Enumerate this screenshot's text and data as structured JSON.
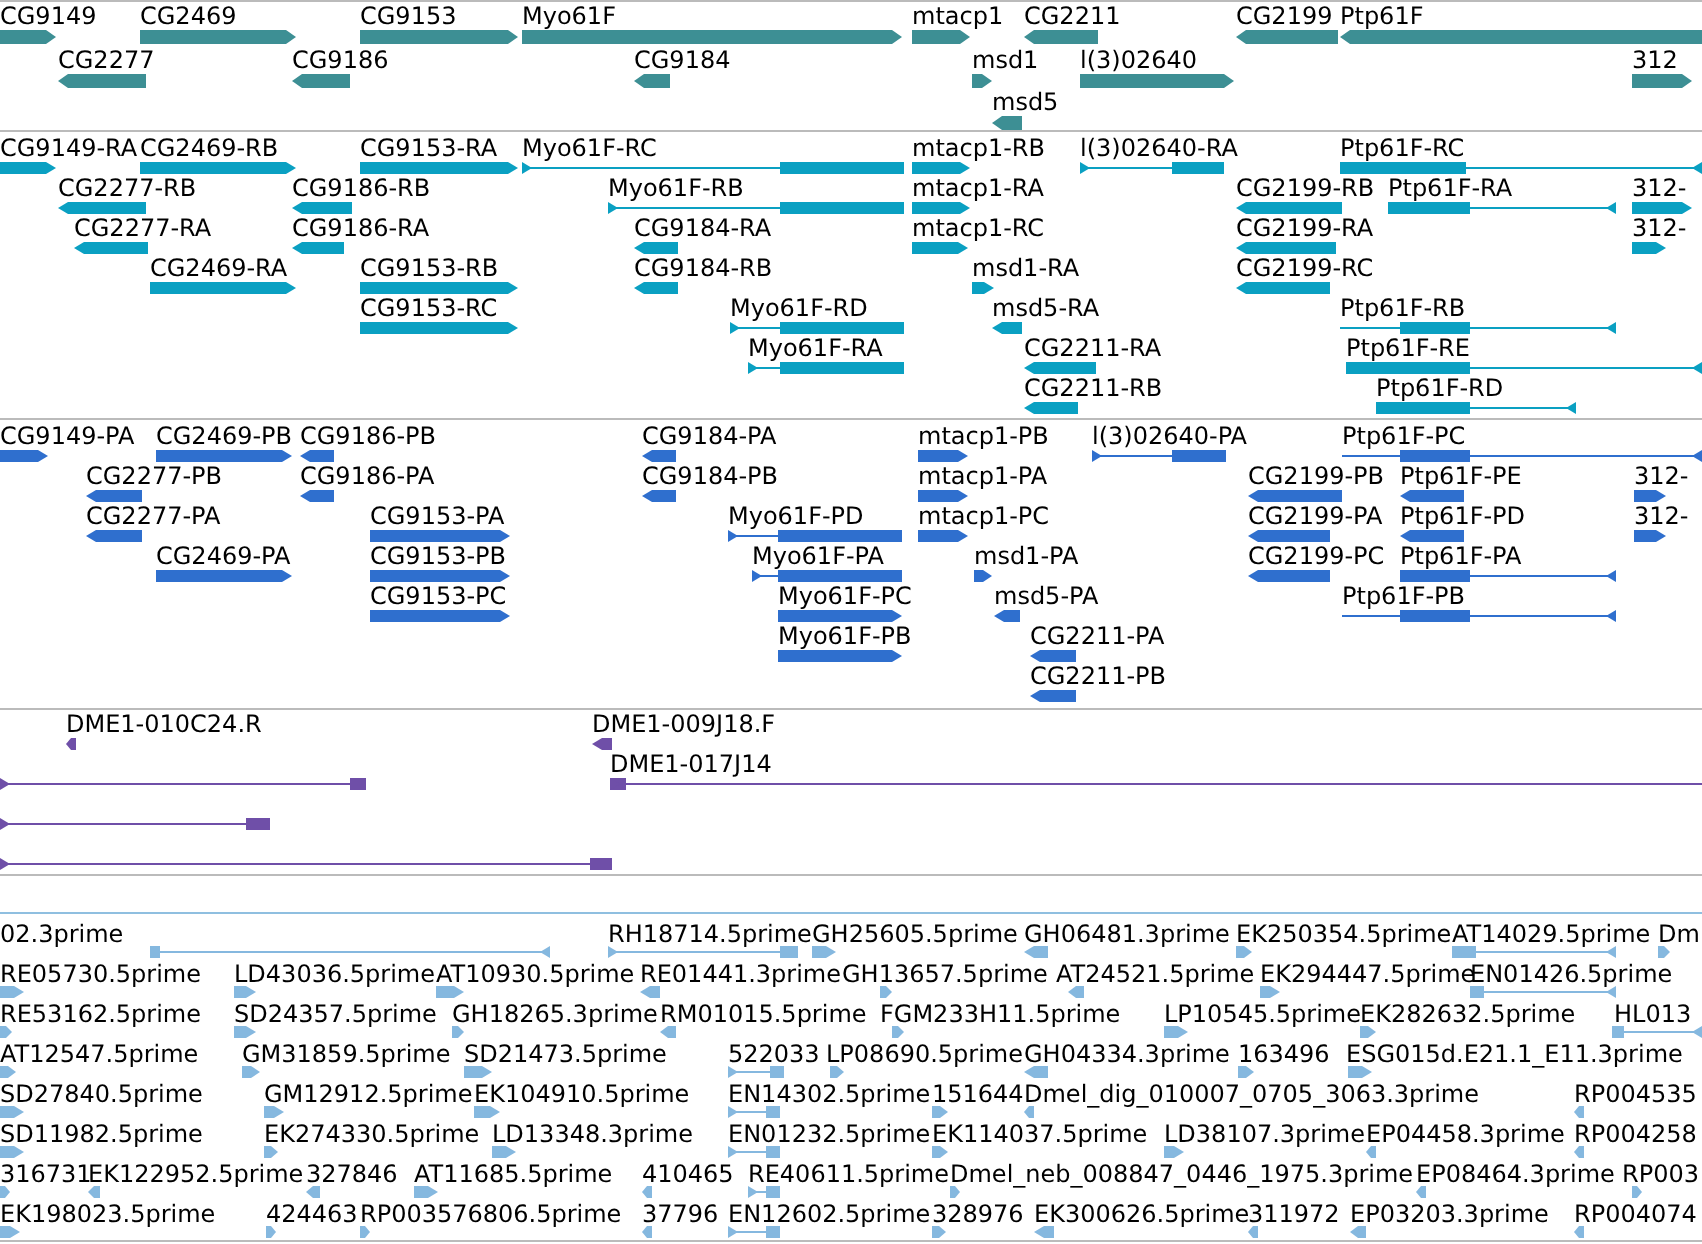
{
  "tracks": [
    {
      "color": "#3d8f94",
      "lanes": [
        {
          "features": [
            {
              "label": "CG9149",
              "reverse": false
            },
            {
              "label": "CG2469",
              "reverse": false
            },
            {
              "label": "CG9153",
              "reverse": false
            },
            {
              "label": "Myo61F",
              "reverse": false
            },
            {
              "label": "mtacp1",
              "reverse": false
            },
            {
              "label": "CG2211",
              "reverse": true
            },
            {
              "label": "CG2199",
              "reverse": true
            },
            {
              "label": "Ptp61F",
              "reverse": true
            }
          ]
        },
        {
          "features": [
            {
              "label": "CG2277",
              "reverse": true
            },
            {
              "label": "CG9186",
              "reverse": true
            },
            {
              "label": "CG9184",
              "reverse": true
            },
            {
              "label": "msd1",
              "reverse": false
            },
            {
              "label": "l(3)02640",
              "reverse": false
            },
            {
              "label": "312",
              "reverse": false
            }
          ]
        },
        {
          "features": [
            {
              "label": "msd5",
              "reverse": true
            }
          ]
        }
      ]
    },
    {
      "color": "#0aa0c2",
      "lanes": [
        {
          "features": [
            {
              "label": "CG9149-RA",
              "reverse": false
            },
            {
              "label": "CG2469-RB",
              "reverse": false
            },
            {
              "label": "CG9153-RA",
              "reverse": false
            },
            {
              "label": "Myo61F-RC",
              "reverse": false
            },
            {
              "label": "mtacp1-RB",
              "reverse": false
            },
            {
              "label": "l(3)02640-RA",
              "reverse": false
            },
            {
              "label": "Ptp61F-RC",
              "reverse": true
            }
          ]
        },
        {
          "features": [
            {
              "label": "CG2277-RB",
              "reverse": true
            },
            {
              "label": "CG9186-RB",
              "reverse": true
            },
            {
              "label": "Myo61F-RB",
              "reverse": false
            },
            {
              "label": "mtacp1-RA",
              "reverse": false
            },
            {
              "label": "CG2199-RB",
              "reverse": true
            },
            {
              "label": "Ptp61F-RA",
              "reverse": true
            },
            {
              "label": "312-",
              "reverse": false
            }
          ]
        },
        {
          "features": [
            {
              "label": "CG2277-RA",
              "reverse": true
            },
            {
              "label": "CG9186-RA",
              "reverse": true
            },
            {
              "label": "CG9184-RA",
              "reverse": true
            },
            {
              "label": "mtacp1-RC",
              "reverse": false
            },
            {
              "label": "CG2199-RA",
              "reverse": true
            },
            {
              "label": "312-",
              "reverse": false
            }
          ]
        },
        {
          "features": [
            {
              "label": "CG2469-RA",
              "reverse": false
            },
            {
              "label": "CG9153-RB",
              "reverse": false
            },
            {
              "label": "CG9184-RB",
              "reverse": true
            },
            {
              "label": "msd1-RA",
              "reverse": false
            },
            {
              "label": "CG2199-RC",
              "reverse": true
            }
          ]
        },
        {
          "features": [
            {
              "label": "CG9153-RC",
              "reverse": false
            },
            {
              "label": "Myo61F-RD",
              "reverse": false
            },
            {
              "label": "msd5-RA",
              "reverse": true
            },
            {
              "label": "Ptp61F-RB",
              "reverse": true
            }
          ]
        },
        {
          "features": [
            {
              "label": "Myo61F-RA",
              "reverse": false
            },
            {
              "label": "CG2211-RA",
              "reverse": true
            },
            {
              "label": "Ptp61F-RE",
              "reverse": true
            }
          ]
        },
        {
          "features": [
            {
              "label": "CG2211-RB",
              "reverse": true
            },
            {
              "label": "Ptp61F-RD",
              "reverse": true
            }
          ]
        }
      ]
    },
    {
      "color": "#2f6fce",
      "lanes": [
        {
          "features": [
            {
              "label": "CG9149-PA",
              "reverse": false
            },
            {
              "label": "CG2469-PB",
              "reverse": false
            },
            {
              "label": "CG9186-PB",
              "reverse": true
            },
            {
              "label": "CG9184-PA",
              "reverse": true
            },
            {
              "label": "mtacp1-PB",
              "reverse": false
            },
            {
              "label": "l(3)02640-PA",
              "reverse": false
            },
            {
              "label": "Ptp61F-PC",
              "reverse": true
            }
          ]
        },
        {
          "features": [
            {
              "label": "CG2277-PB",
              "reverse": true
            },
            {
              "label": "CG9186-PA",
              "reverse": true
            },
            {
              "label": "CG9184-PB",
              "reverse": true
            },
            {
              "label": "mtacp1-PA",
              "reverse": false
            },
            {
              "label": "CG2199-PB",
              "reverse": true
            },
            {
              "label": "Ptp61F-PE",
              "reverse": true
            },
            {
              "label": "312-",
              "reverse": false
            }
          ]
        },
        {
          "features": [
            {
              "label": "CG2277-PA",
              "reverse": true
            },
            {
              "label": "CG9153-PA",
              "reverse": false
            },
            {
              "label": "Myo61F-PD",
              "reverse": false
            },
            {
              "label": "mtacp1-PC",
              "reverse": false
            },
            {
              "label": "CG2199-PA",
              "reverse": true
            },
            {
              "label": "Ptp61F-PD",
              "reverse": true
            },
            {
              "label": "312-",
              "reverse": false
            }
          ]
        },
        {
          "features": [
            {
              "label": "CG2469-PA",
              "reverse": false
            },
            {
              "label": "CG9153-PB",
              "reverse": false
            },
            {
              "label": "Myo61F-PA",
              "reverse": false
            },
            {
              "label": "msd1-PA",
              "reverse": false
            },
            {
              "label": "CG2199-PC",
              "reverse": true
            },
            {
              "label": "Ptp61F-PA",
              "reverse": true
            }
          ]
        },
        {
          "features": [
            {
              "label": "CG9153-PC",
              "reverse": false
            },
            {
              "label": "Myo61F-PC",
              "reverse": false
            },
            {
              "label": "msd5-PA",
              "reverse": true
            },
            {
              "label": "Ptp61F-PB",
              "reverse": true
            }
          ]
        },
        {
          "features": [
            {
              "label": "Myo61F-PB",
              "reverse": false
            },
            {
              "label": "CG2211-PA",
              "reverse": true
            }
          ]
        },
        {
          "features": [
            {
              "label": "CG2211-PB",
              "reverse": true
            }
          ]
        }
      ]
    },
    {
      "color": "#6f4fa8",
      "lanes": [
        {
          "features": [
            {
              "label": "DME1-010C24.R",
              "reverse": true
            },
            {
              "label": "DME1-009J18.F",
              "reverse": true
            }
          ]
        },
        {
          "features": [
            {
              "reverse": false
            },
            {
              "label": "DME1-017J14",
              "reverse": false
            }
          ]
        },
        {
          "features": [
            {
              "reverse": false
            }
          ]
        },
        {
          "features": [
            {
              "reverse": false
            }
          ]
        }
      ]
    },
    {
      "color": "#85b8df",
      "lanes": [
        {
          "features": [
            {
              "label": "02.3prime",
              "reverse": true
            },
            {
              "label": "RH18714.5prime",
              "reverse": false
            },
            {
              "label": "GH25605.5prime",
              "reverse": false
            },
            {
              "label": "GH06481.3prime",
              "reverse": true
            },
            {
              "label": "EK250354.5prime",
              "reverse": false
            },
            {
              "label": "AT14029.5prime",
              "reverse": true
            },
            {
              "label": "Dm",
              "reverse": false
            }
          ]
        },
        {
          "features": [
            {
              "label": "RE05730.5prime",
              "reverse": false
            },
            {
              "label": "LD43036.5prime",
              "reverse": false
            },
            {
              "label": "AT10930.5prime",
              "reverse": false
            },
            {
              "label": "RE01441.3prime",
              "reverse": true
            },
            {
              "label": "GH13657.5prime",
              "reverse": false
            },
            {
              "label": "AT24521.5prime",
              "reverse": true
            },
            {
              "label": "EK294447.5prime",
              "reverse": false
            },
            {
              "label": "EN01426.5prime",
              "reverse": true
            }
          ]
        },
        {
          "features": [
            {
              "label": "RE53162.5prime",
              "reverse": false
            },
            {
              "label": "SD24357.5prime",
              "reverse": false
            },
            {
              "label": "GH18265.3prime",
              "reverse": false
            },
            {
              "label": "RM01015.5prime",
              "reverse": true
            },
            {
              "label": "FGM233H11.5prime",
              "reverse": false
            },
            {
              "label": "LP10545.5prime",
              "reverse": false
            },
            {
              "label": "EK282632.5prime",
              "reverse": false
            },
            {
              "label": "HL013",
              "reverse": true
            }
          ]
        },
        {
          "features": [
            {
              "label": "AT12547.5prime",
              "reverse": false
            },
            {
              "label": "GM31859.5prime",
              "reverse": false
            },
            {
              "label": "SD21473.5prime",
              "reverse": false
            },
            {
              "label": "522033",
              "reverse": false
            },
            {
              "label": "LP08690.5prime",
              "reverse": false
            },
            {
              "label": "GH04334.3prime",
              "reverse": true
            },
            {
              "label": "163496",
              "reverse": false
            },
            {
              "label": "ESG015d.E21.1_E11.3prime",
              "reverse": false
            }
          ]
        },
        {
          "features": [
            {
              "label": "SD27840.5prime",
              "reverse": false
            },
            {
              "label": "GM12912.5prime",
              "reverse": false
            },
            {
              "label": "EK104910.5prime",
              "reverse": false
            },
            {
              "label": "EN14302.5prime",
              "reverse": false
            },
            {
              "label": "151644",
              "reverse": false
            },
            {
              "label": "Dmel_dig_010007_0705_3063.3prime",
              "reverse": true
            },
            {
              "label": "RP004535",
              "reverse": true
            }
          ]
        },
        {
          "features": [
            {
              "label": "SD11982.5prime",
              "reverse": false
            },
            {
              "label": "EK274330.5prime",
              "reverse": false
            },
            {
              "label": "LD13348.3prime",
              "reverse": false
            },
            {
              "label": "EN01232.5prime",
              "reverse": false
            },
            {
              "label": "EK114037.5prime",
              "reverse": false
            },
            {
              "label": "LD38107.3prime",
              "reverse": false
            },
            {
              "label": "EP04458.3prime",
              "reverse": true
            },
            {
              "label": "RP004258",
              "reverse": true
            }
          ]
        },
        {
          "features": [
            {
              "label": "316731",
              "reverse": false
            },
            {
              "label": "EK122952.5prime",
              "reverse": true
            },
            {
              "label": "327846",
              "reverse": true
            },
            {
              "label": "AT11685.5prime",
              "reverse": false
            },
            {
              "label": "410465",
              "reverse": true
            },
            {
              "label": "RE40611.5prime",
              "reverse": false
            },
            {
              "label": "Dmel_neb_008847_0446_1975.3prime",
              "reverse": false
            },
            {
              "label": "EP08464.3prime",
              "reverse": true
            },
            {
              "label": "RP003",
              "reverse": false
            }
          ]
        },
        {
          "features": [
            {
              "label": "EK198023.5prime",
              "reverse": false
            },
            {
              "label": "424463",
              "reverse": false
            },
            {
              "label": "RP003576806.5prime",
              "reverse": false
            },
            {
              "label": "37796",
              "reverse": true
            },
            {
              "label": "EN12602.5prime",
              "reverse": false
            },
            {
              "label": "328976",
              "reverse": false
            },
            {
              "label": "EK300626.5prime",
              "reverse": true
            },
            {
              "label": "311972",
              "reverse": true
            },
            {
              "label": "EP03203.3prime",
              "reverse": true
            },
            {
              "label": "RP004074",
              "reverse": true
            }
          ]
        }
      ]
    }
  ]
}
